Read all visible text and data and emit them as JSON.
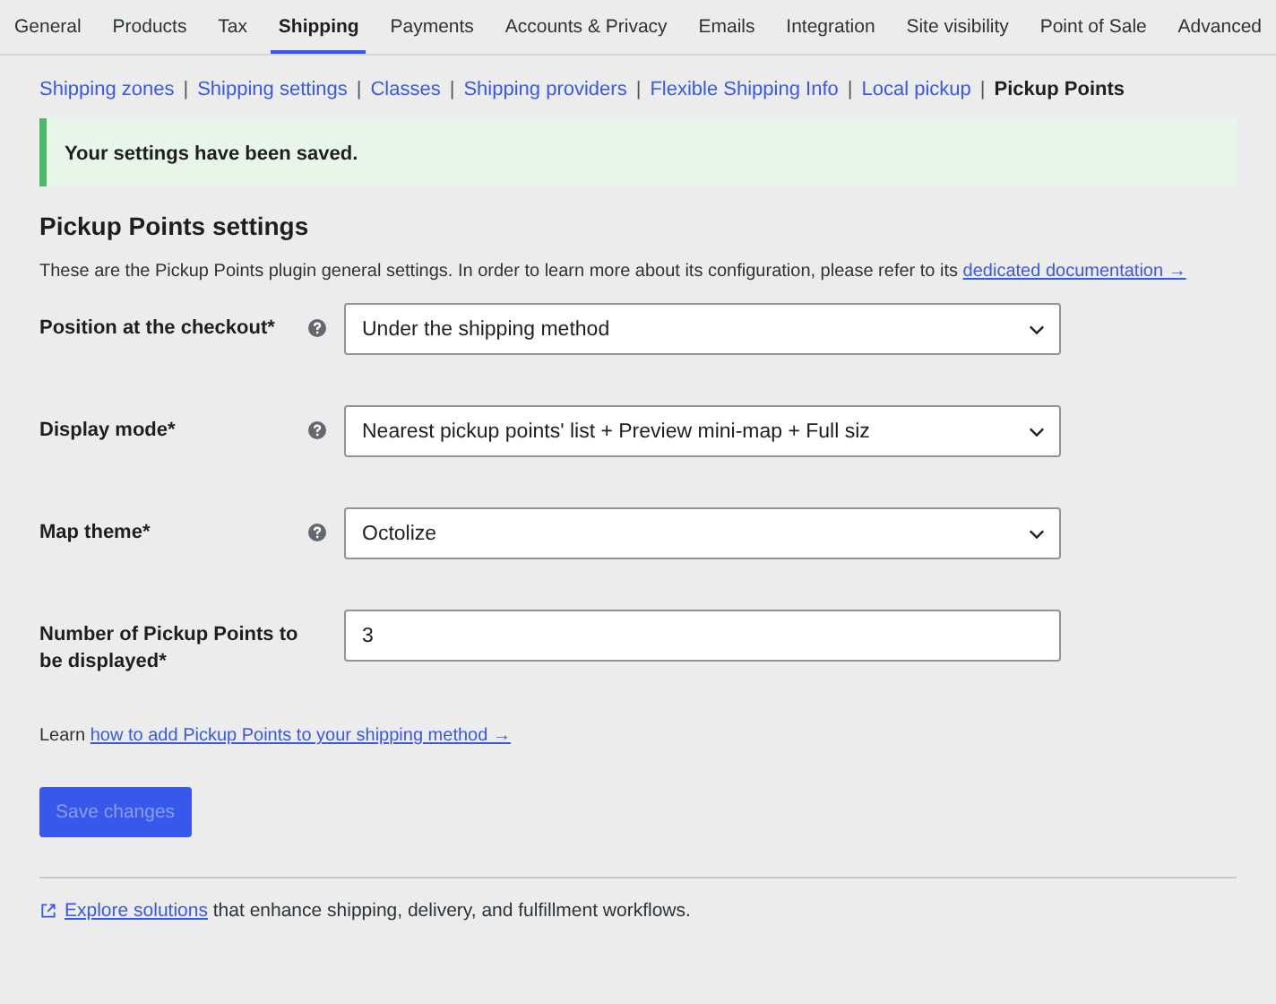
{
  "tabs": [
    {
      "label": "General",
      "selected": false
    },
    {
      "label": "Products",
      "selected": false
    },
    {
      "label": "Tax",
      "selected": false
    },
    {
      "label": "Shipping",
      "selected": true
    },
    {
      "label": "Payments",
      "selected": false
    },
    {
      "label": "Accounts & Privacy",
      "selected": false
    },
    {
      "label": "Emails",
      "selected": false
    },
    {
      "label": "Integration",
      "selected": false
    },
    {
      "label": "Site visibility",
      "selected": false
    },
    {
      "label": "Point of Sale",
      "selected": false
    },
    {
      "label": "Advanced",
      "selected": false
    }
  ],
  "subnav": [
    {
      "label": "Shipping zones",
      "selected": false
    },
    {
      "label": "Shipping settings",
      "selected": false
    },
    {
      "label": "Classes",
      "selected": false
    },
    {
      "label": "Shipping providers",
      "selected": false
    },
    {
      "label": "Flexible Shipping Info",
      "selected": false
    },
    {
      "label": "Local pickup",
      "selected": false
    },
    {
      "label": "Pickup Points",
      "selected": true
    }
  ],
  "separator": "|",
  "notice": "Your settings have been saved.",
  "heading": "Pickup Points settings",
  "intro": {
    "text": "These are the Pickup Points plugin general settings. In order to learn more about its configuration, please refer to its ",
    "link": "dedicated documentation →"
  },
  "fields": [
    {
      "kind": "select",
      "label": "Position at the checkout*",
      "help": true,
      "value": "Under the shipping method"
    },
    {
      "kind": "select",
      "label": "Display mode*",
      "help": true,
      "value": "Nearest pickup points' list + Preview mini-map + Full siz"
    },
    {
      "kind": "select",
      "label": "Map theme*",
      "help": true,
      "value": "Octolize"
    },
    {
      "kind": "text",
      "label": "Number of Pickup Points to be displayed*",
      "help": false,
      "value": "3"
    }
  ],
  "learn": {
    "text": "Learn ",
    "link": "how to add Pickup Points to your shipping method →"
  },
  "save_button": {
    "label": "Save changes",
    "disabled": true
  },
  "footer": {
    "link": "Explore solutions",
    "text": " that enhance shipping, delivery, and fulfillment workflows."
  }
}
